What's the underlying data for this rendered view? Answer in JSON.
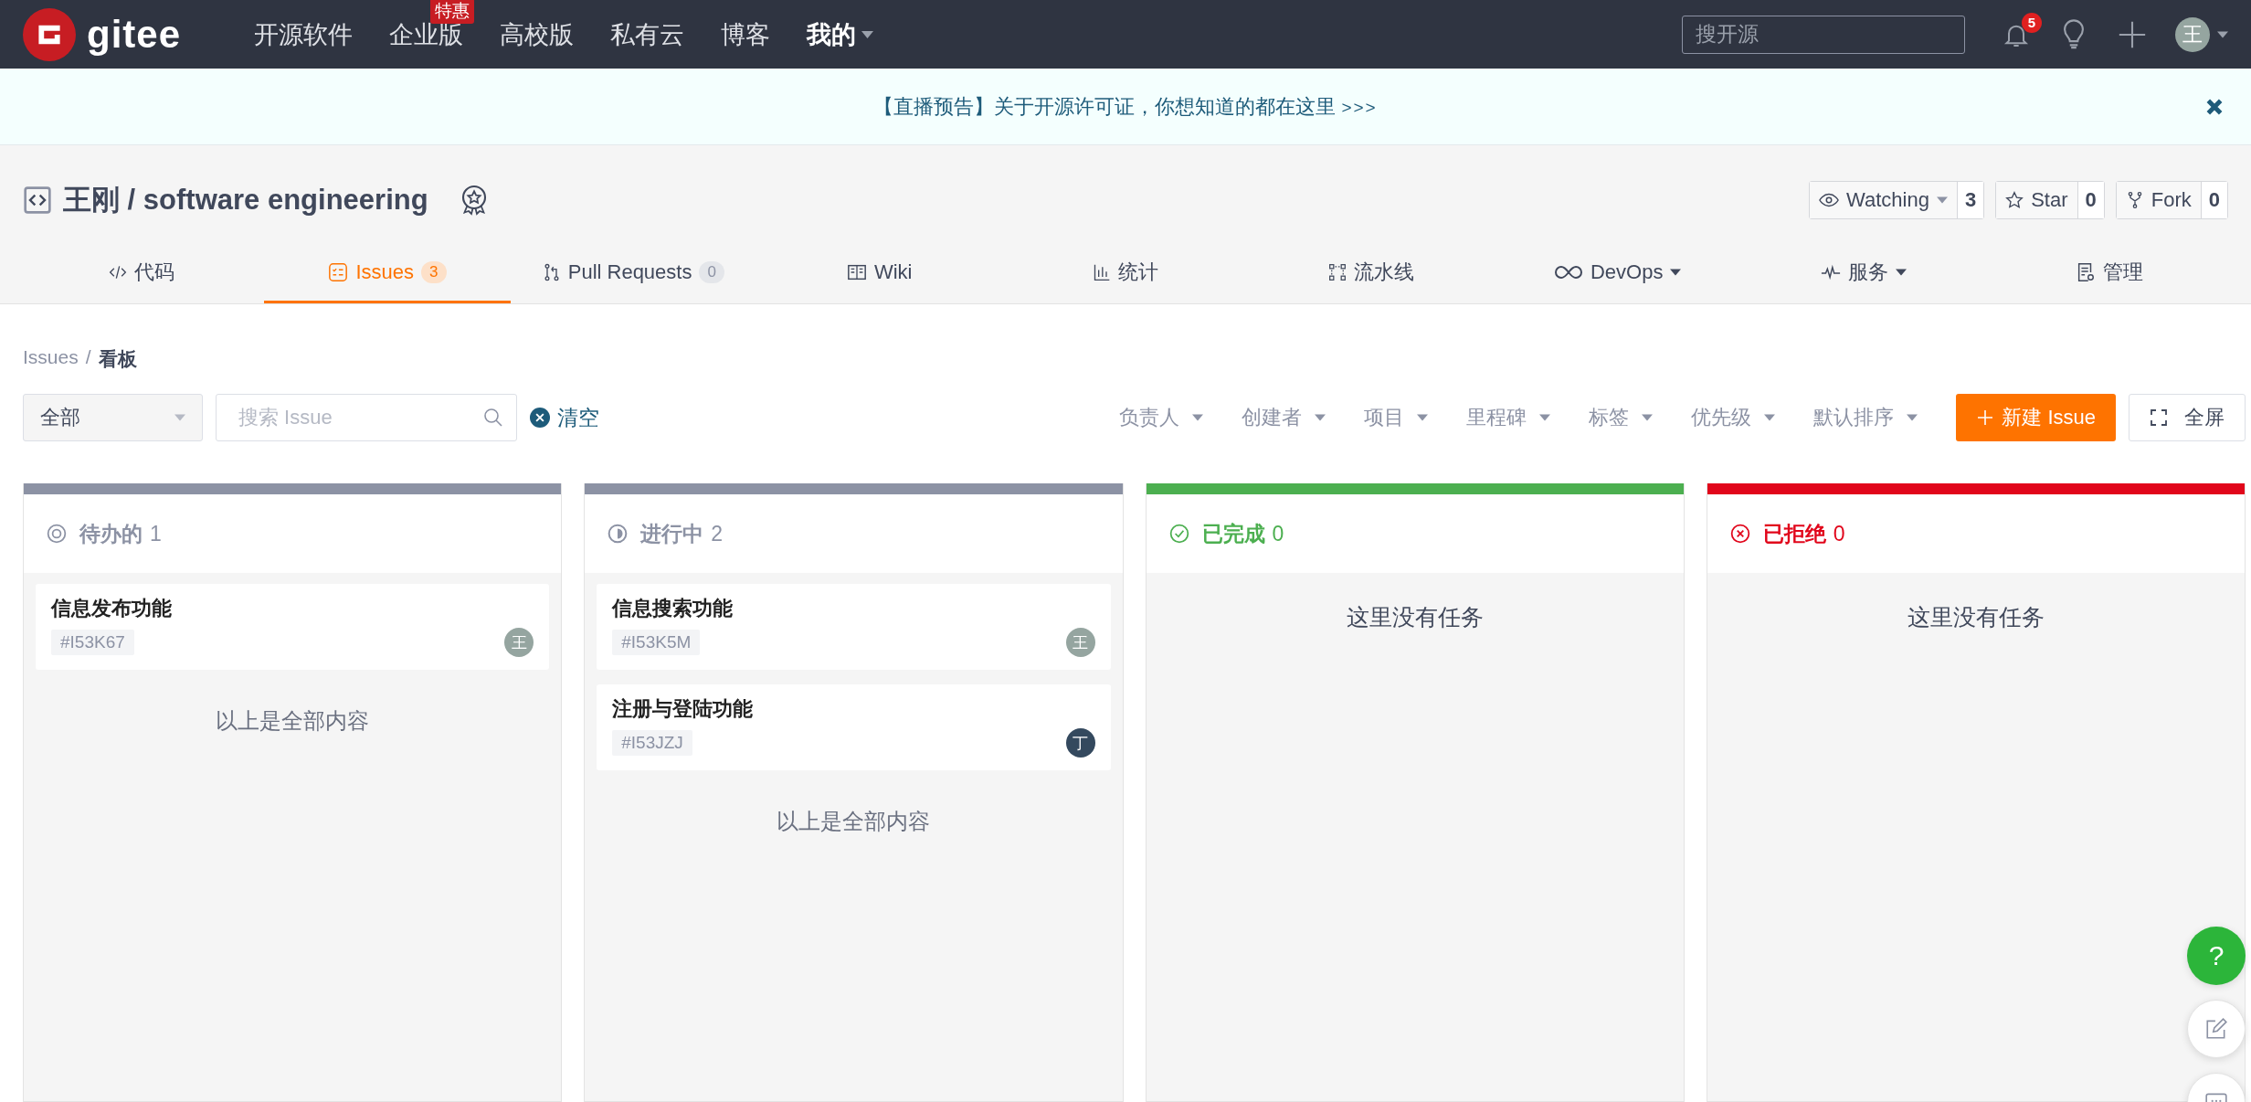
{
  "nav": {
    "logo": "gitee",
    "links": [
      {
        "label": "开源软件",
        "selected": false
      },
      {
        "label": "企业版",
        "badge": "特惠",
        "selected": false
      },
      {
        "label": "高校版",
        "selected": false
      },
      {
        "label": "私有云",
        "selected": false
      },
      {
        "label": "博客",
        "selected": false
      },
      {
        "label": "我的",
        "dropdown": true,
        "selected": true
      }
    ],
    "search": {
      "placeholder": "搜开源"
    },
    "notifications": "5",
    "avatar": "王"
  },
  "banner": {
    "text": "【直播预告】关于开源许可证，你想知道的都在这里",
    "arrow": ">>>"
  },
  "repo": {
    "title": "王刚 / software engineering",
    "actions": [
      {
        "kind": "eye",
        "label": "Watching",
        "dropdown": true,
        "count": "3"
      },
      {
        "kind": "star",
        "label": "Star",
        "count": "0"
      },
      {
        "kind": "fork",
        "label": "Fork",
        "count": "0"
      }
    ]
  },
  "tabs": [
    {
      "kind": "code",
      "label": "代码",
      "selected": false
    },
    {
      "kind": "issues",
      "label": "Issues",
      "badge": "3",
      "selected": true
    },
    {
      "kind": "pr",
      "label": "Pull Requests",
      "badge": "0",
      "selected": false
    },
    {
      "kind": "wiki",
      "label": "Wiki",
      "selected": false
    },
    {
      "kind": "stats",
      "label": "统计",
      "selected": false
    },
    {
      "kind": "pipeline",
      "label": "流水线",
      "selected": false
    },
    {
      "kind": "devops",
      "label": "DevOps",
      "dropdown": true,
      "selected": false
    },
    {
      "kind": "service",
      "label": "服务",
      "dropdown": true,
      "selected": false
    },
    {
      "kind": "manage",
      "label": "管理",
      "selected": false
    }
  ],
  "breadcrumb": {
    "parent": "Issues",
    "separator": "/",
    "current": "看板"
  },
  "filters": {
    "status": "全部",
    "search": {
      "placeholder": "搜索 Issue"
    },
    "clear": "清空",
    "dropdowns": [
      "负责人",
      "创建者",
      "项目",
      "里程碑",
      "标签",
      "优先级",
      "默认排序"
    ],
    "new_button": "新建 Issue",
    "fullscreen": "全屏"
  },
  "columns": [
    {
      "kind": "todo",
      "title": "待办的",
      "count": "1",
      "color": "#8c92a4",
      "issues": [
        {
          "title": "信息发布功能",
          "id": "#I53K67",
          "assignee": "王",
          "color": "#95a5a0"
        }
      ],
      "footer": "以上是全部内容"
    },
    {
      "kind": "progress",
      "title": "进行中",
      "count": "2",
      "color": "#8c92a4",
      "issues": [
        {
          "title": "信息搜索功能",
          "id": "#I53K5M",
          "assignee": "王",
          "color": "#95a5a0"
        },
        {
          "title": "注册与登陆功能",
          "id": "#I53JZJ",
          "assignee": "丁",
          "color": "#34495e"
        }
      ],
      "footer": "以上是全部内容"
    },
    {
      "kind": "done",
      "title": "已完成",
      "count": "0",
      "color": "#4caf50",
      "empty_text": "这里没有任务"
    },
    {
      "kind": "rejected",
      "title": "已拒绝",
      "count": "0",
      "color": "#e1061b",
      "empty_text": "这里没有任务"
    }
  ],
  "float_buttons": [
    {
      "kind": "help",
      "label": "?"
    },
    {
      "kind": "edit"
    },
    {
      "kind": "chat"
    }
  ]
}
